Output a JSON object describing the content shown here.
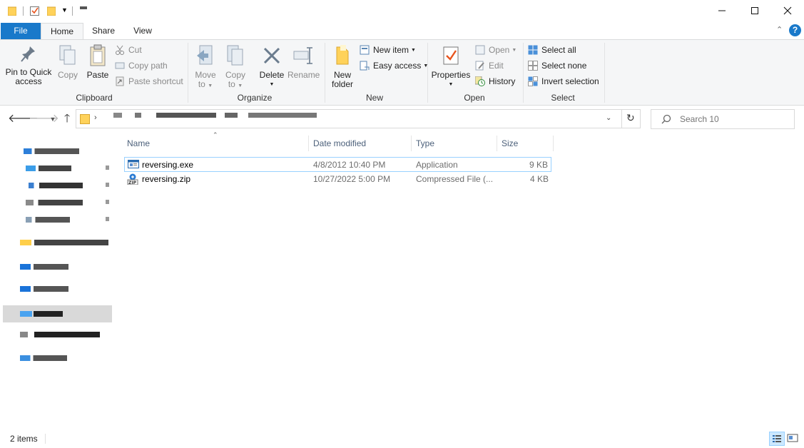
{
  "ribbon": {
    "tabs": {
      "file": "File",
      "home": "Home",
      "share": "Share",
      "view": "View"
    },
    "clipboard": {
      "pin_line1": "Pin to Quick",
      "pin_line2": "access",
      "copy": "Copy",
      "paste": "Paste",
      "cut": "Cut",
      "copy_path": "Copy path",
      "paste_shortcut": "Paste shortcut",
      "label": "Clipboard"
    },
    "organize": {
      "move_line1": "Move",
      "move_line2": "to",
      "copy_line1": "Copy",
      "copy_line2": "to",
      "delete": "Delete",
      "rename": "Rename",
      "label": "Organize"
    },
    "new": {
      "folder_line1": "New",
      "folder_line2": "folder",
      "new_item": "New item",
      "easy_access": "Easy access",
      "label": "New"
    },
    "open": {
      "properties": "Properties",
      "open": "Open",
      "edit": "Edit",
      "history": "History",
      "label": "Open"
    },
    "select": {
      "select_all": "Select all",
      "select_none": "Select none",
      "invert_selection": "Invert selection",
      "label": "Select"
    }
  },
  "search": {
    "placeholder": "Search 10"
  },
  "columns": {
    "name": "Name",
    "date_modified": "Date modified",
    "type": "Type",
    "size": "Size"
  },
  "files": [
    {
      "name": "reversing.exe",
      "date": "4/8/2012 10:40 PM",
      "type": "Application",
      "size": "9 KB"
    },
    {
      "name": "reversing.zip",
      "date": "10/27/2022 5:00 PM",
      "type": "Compressed File (...",
      "size": "4 KB"
    }
  ],
  "status": {
    "items": "2 items"
  },
  "colors": {
    "accent": "#1979ca",
    "folder": "#ffd25a",
    "selection": "#cce8ff"
  }
}
